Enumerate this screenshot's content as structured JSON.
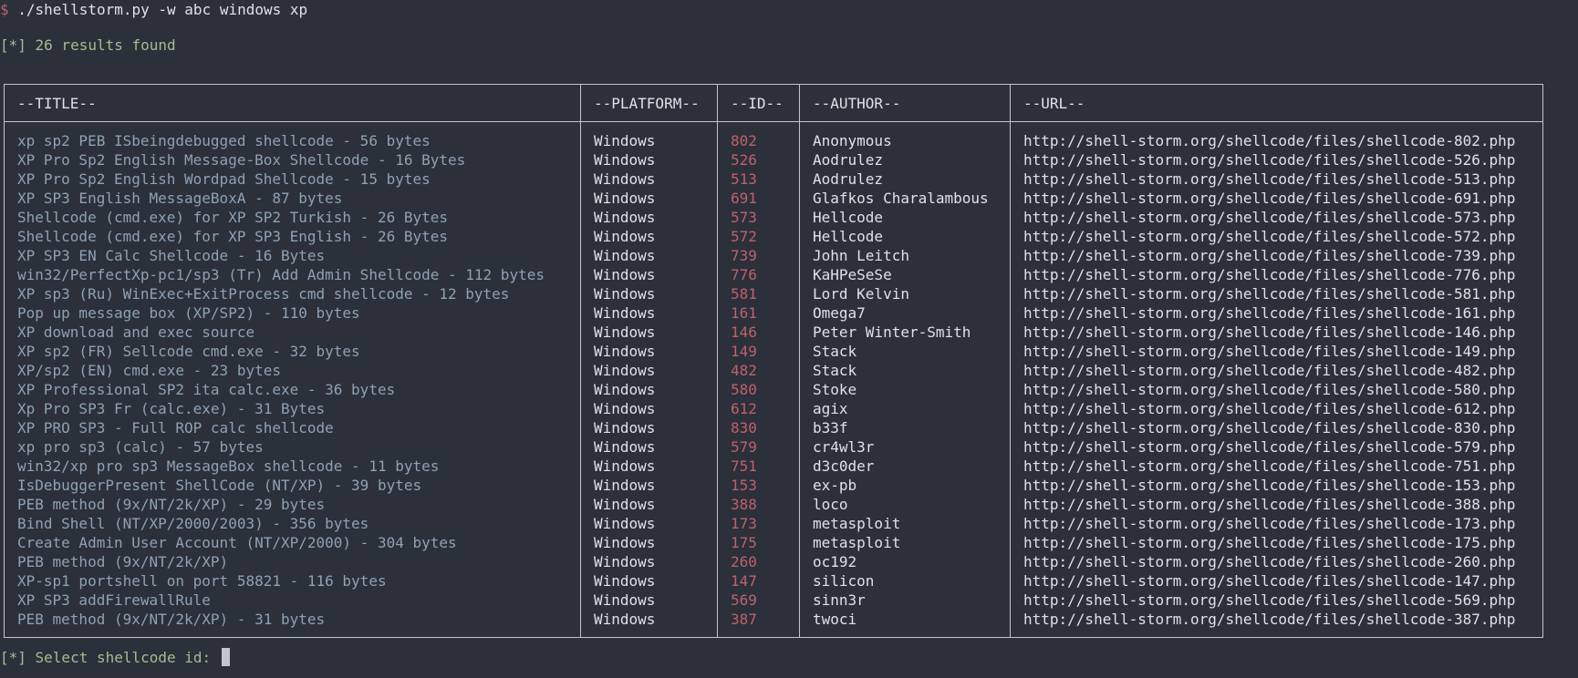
{
  "terminal": {
    "prompt_symbol": "$",
    "command": " ./shellstorm.py -w abc windows xp",
    "results_text": "[*] 26 results found",
    "select_prompt": "[*] Select shellcode id: "
  },
  "table": {
    "headers": {
      "title": "--TITLE--",
      "platform": "--PLATFORM--",
      "id": "--ID--",
      "author": "--AUTHOR--",
      "url": "--URL--"
    },
    "rows": [
      {
        "title": "xp sp2 PEB ISbeingdebugged shellcode - 56 bytes",
        "platform": "Windows",
        "id": "802",
        "author": "Anonymous",
        "url": "http://shell-storm.org/shellcode/files/shellcode-802.php"
      },
      {
        "title": "XP Pro Sp2 English Message-Box Shellcode - 16 Bytes",
        "platform": "Windows",
        "id": "526",
        "author": "Aodrulez",
        "url": "http://shell-storm.org/shellcode/files/shellcode-526.php"
      },
      {
        "title": "XP Pro Sp2 English Wordpad Shellcode - 15 bytes",
        "platform": "Windows",
        "id": "513",
        "author": "Aodrulez",
        "url": "http://shell-storm.org/shellcode/files/shellcode-513.php"
      },
      {
        "title": "XP SP3 English MessageBoxA - 87 bytes",
        "platform": "Windows",
        "id": "691",
        "author": "Glafkos Charalambous",
        "url": "http://shell-storm.org/shellcode/files/shellcode-691.php"
      },
      {
        "title": "Shellcode (cmd.exe) for XP SP2 Turkish - 26 Bytes",
        "platform": "Windows",
        "id": "573",
        "author": "Hellcode",
        "url": "http://shell-storm.org/shellcode/files/shellcode-573.php"
      },
      {
        "title": "Shellcode (cmd.exe) for XP SP3 English - 26 Bytes",
        "platform": "Windows",
        "id": "572",
        "author": "Hellcode",
        "url": "http://shell-storm.org/shellcode/files/shellcode-572.php"
      },
      {
        "title": "XP SP3 EN Calc Shellcode - 16 Bytes",
        "platform": "Windows",
        "id": "739",
        "author": "John Leitch",
        "url": "http://shell-storm.org/shellcode/files/shellcode-739.php"
      },
      {
        "title": "win32/PerfectXp-pc1/sp3 (Tr) Add Admin Shellcode - 112 bytes",
        "platform": "Windows",
        "id": "776",
        "author": "KaHPeSeSe",
        "url": "http://shell-storm.org/shellcode/files/shellcode-776.php"
      },
      {
        "title": "XP sp3 (Ru) WinExec+ExitProcess cmd shellcode - 12 bytes",
        "platform": "Windows",
        "id": "581",
        "author": "Lord Kelvin",
        "url": "http://shell-storm.org/shellcode/files/shellcode-581.php"
      },
      {
        "title": "Pop up message box (XP/SP2) - 110 bytes",
        "platform": "Windows",
        "id": "161",
        "author": "Omega7",
        "url": "http://shell-storm.org/shellcode/files/shellcode-161.php"
      },
      {
        "title": "XP download and exec source",
        "platform": "Windows",
        "id": "146",
        "author": "Peter Winter-Smith",
        "url": "http://shell-storm.org/shellcode/files/shellcode-146.php"
      },
      {
        "title": "XP sp2 (FR) Sellcode cmd.exe - 32 bytes",
        "platform": "Windows",
        "id": "149",
        "author": "Stack",
        "url": "http://shell-storm.org/shellcode/files/shellcode-149.php"
      },
      {
        "title": "XP/sp2 (EN) cmd.exe - 23 bytes",
        "platform": "Windows",
        "id": "482",
        "author": "Stack",
        "url": "http://shell-storm.org/shellcode/files/shellcode-482.php"
      },
      {
        "title": "XP Professional SP2 ita calc.exe - 36 bytes",
        "platform": "Windows",
        "id": "580",
        "author": "Stoke",
        "url": "http://shell-storm.org/shellcode/files/shellcode-580.php"
      },
      {
        "title": "Xp Pro SP3 Fr (calc.exe) - 31 Bytes",
        "platform": "Windows",
        "id": "612",
        "author": "agix",
        "url": "http://shell-storm.org/shellcode/files/shellcode-612.php"
      },
      {
        "title": "XP PRO SP3 - Full ROP calc shellcode",
        "platform": "Windows",
        "id": "830",
        "author": "b33f",
        "url": "http://shell-storm.org/shellcode/files/shellcode-830.php"
      },
      {
        "title": "xp pro sp3 (calc) - 57 bytes",
        "platform": "Windows",
        "id": "579",
        "author": "cr4wl3r",
        "url": "http://shell-storm.org/shellcode/files/shellcode-579.php"
      },
      {
        "title": "win32/xp pro sp3 MessageBox shellcode - 11 bytes",
        "platform": "Windows",
        "id": "751",
        "author": "d3c0der",
        "url": "http://shell-storm.org/shellcode/files/shellcode-751.php"
      },
      {
        "title": "IsDebuggerPresent ShellCode (NT/XP) - 39 bytes",
        "platform": "Windows",
        "id": "153",
        "author": "ex-pb",
        "url": "http://shell-storm.org/shellcode/files/shellcode-153.php"
      },
      {
        "title": "PEB method (9x/NT/2k/XP) - 29 bytes",
        "platform": "Windows",
        "id": "388",
        "author": "loco",
        "url": "http://shell-storm.org/shellcode/files/shellcode-388.php"
      },
      {
        "title": "Bind Shell (NT/XP/2000/2003) - 356 bytes",
        "platform": "Windows",
        "id": "173",
        "author": "metasploit",
        "url": "http://shell-storm.org/shellcode/files/shellcode-173.php"
      },
      {
        "title": "Create Admin User Account (NT/XP/2000) - 304 bytes",
        "platform": "Windows",
        "id": "175",
        "author": "metasploit",
        "url": "http://shell-storm.org/shellcode/files/shellcode-175.php"
      },
      {
        "title": "PEB method (9x/NT/2k/XP)",
        "platform": "Windows",
        "id": "260",
        "author": "oc192",
        "url": "http://shell-storm.org/shellcode/files/shellcode-260.php"
      },
      {
        "title": "XP-sp1 portshell on port 58821 - 116 bytes",
        "platform": "Windows",
        "id": "147",
        "author": "silicon",
        "url": "http://shell-storm.org/shellcode/files/shellcode-147.php"
      },
      {
        "title": "XP SP3 addFirewallRule",
        "platform": "Windows",
        "id": "569",
        "author": "sinn3r",
        "url": "http://shell-storm.org/shellcode/files/shellcode-569.php"
      },
      {
        "title": "PEB method (9x/NT/2k/XP) - 31 bytes",
        "platform": "Windows",
        "id": "387",
        "author": "twoci",
        "url": "http://shell-storm.org/shellcode/files/shellcode-387.php"
      }
    ]
  },
  "colors": {
    "background": "#2b303b",
    "prompt": "#bf616a",
    "info": "#a3be8c",
    "title_text": "#8fa1b3",
    "id_text": "#bf616a",
    "plain_text": "#dfe1e8"
  }
}
